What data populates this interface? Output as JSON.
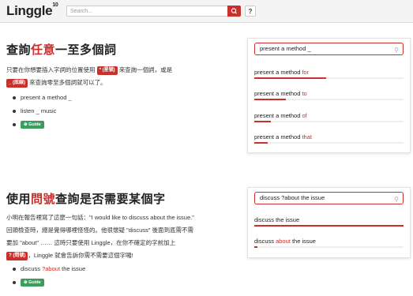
{
  "topbar": {
    "logo": "Linggle",
    "logo_sup": "10",
    "search_placeholder": "Search...",
    "help_label": "?"
  },
  "section1": {
    "title_pre": "查詢",
    "title_hl": "任意",
    "title_post": "一至多個詞",
    "para_1": "只要在你想要插入字詞的位置使用",
    "tag_1": "* (星號)",
    "para_2": "來查詢一個詞，或是",
    "tag_2": "_ (底線)",
    "para_3": "來查詢零至多個詞就可以了。",
    "examples": [
      {
        "pre": "present a method ",
        "hl": "_",
        "post": ""
      },
      {
        "pre": "listen _ music",
        "hl": "",
        "post": ""
      }
    ],
    "guide_label": "⊕ Guide"
  },
  "panel1": {
    "query": "present a method _",
    "results": [
      {
        "pre": "present a method ",
        "hl": "for",
        "fill": 0.48
      },
      {
        "pre": "present a method ",
        "hl": "to",
        "fill": 0.21
      },
      {
        "pre": "present a method ",
        "hl": "of",
        "fill": 0.11
      },
      {
        "pre": "present a method ",
        "hl": "that",
        "fill": 0.09
      }
    ]
  },
  "section2": {
    "title_pre": "使用",
    "title_hl": "問號",
    "title_post": "查詢是否需要某個字",
    "line_1": "小明在報告裡寫了這麼一句話：\"I would like to discuss about the issue.\"",
    "line_2": "回頭檢查時，總是覺得哪裡怪怪的。他很懷疑 \"discuss\" 後面到底需不需",
    "line_3": "要加 \"about\" …… 這時只要使用 Linggle，在你不確定的字前加上",
    "tag": "? (問號)",
    "line_4": "，Linggle 就會告訴你需不需要這個字囉!",
    "example_pre": "discuss ",
    "example_hl": "?about",
    "example_post": " the issue",
    "guide_label": "⊕ Guide"
  },
  "panel2": {
    "query": "discuss ?about the issue",
    "results": [
      {
        "pre": "discuss the issue",
        "hl": "",
        "post": "",
        "fill": 1.0
      },
      {
        "pre": "discuss ",
        "hl": "about",
        "post": " the issue",
        "fill": 0.02
      }
    ]
  },
  "colors": {
    "accent": "#c9302c",
    "guide": "#3a9f5c"
  },
  "icons": {
    "search": "search-icon",
    "magnifier": "magnifier-icon"
  }
}
